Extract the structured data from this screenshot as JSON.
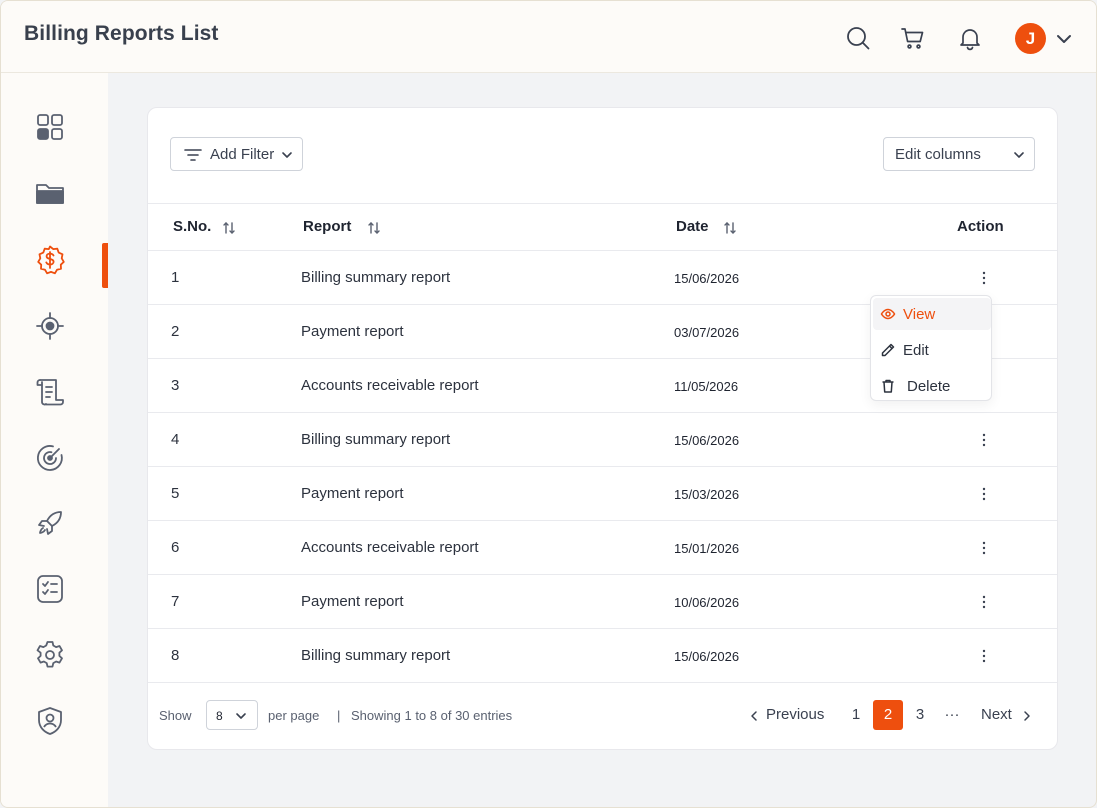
{
  "header": {
    "title": "Billing Reports List",
    "icons": [
      "search-icon",
      "cart-icon",
      "bell-icon"
    ],
    "user_initial": "J"
  },
  "sidebar": {
    "items": [
      {
        "icon": "dashboard-grid-icon",
        "active": false
      },
      {
        "icon": "folder-icon",
        "active": false
      },
      {
        "icon": "billing-dollar-icon",
        "active": true
      },
      {
        "icon": "target-icon",
        "active": false
      },
      {
        "icon": "scroll-document-icon",
        "active": false
      },
      {
        "icon": "radar-icon",
        "active": false
      },
      {
        "icon": "rocket-icon",
        "active": false
      },
      {
        "icon": "checklist-icon",
        "active": false
      },
      {
        "icon": "gear-icon",
        "active": false
      },
      {
        "icon": "shield-user-icon",
        "active": false
      }
    ]
  },
  "toolbar": {
    "filter_label": "Add Filter",
    "columns_label": "Edit columns"
  },
  "table": {
    "headers": {
      "sno": "S.No.",
      "report": "Report",
      "date": "Date",
      "action": "Action"
    },
    "rows": [
      {
        "sno": "1",
        "report": "Billing summary report",
        "date": "15/06/2026"
      },
      {
        "sno": "2",
        "report": "Payment report",
        "date": "03/07/2026"
      },
      {
        "sno": "3",
        "report": "Accounts receivable report",
        "date": "11/05/2026"
      },
      {
        "sno": "4",
        "report": "Billing summary report",
        "date": "15/06/2026"
      },
      {
        "sno": "5",
        "report": "Payment report",
        "date": "15/03/2026"
      },
      {
        "sno": "6",
        "report": "Accounts receivable report",
        "date": "15/01/2026"
      },
      {
        "sno": "7",
        "report": "Payment report",
        "date": "10/06/2026"
      },
      {
        "sno": "8",
        "report": "Billing summary report",
        "date": "15/06/2026"
      }
    ]
  },
  "action_menu": {
    "view": "View",
    "edit": "Edit",
    "delete": "Delete"
  },
  "footer": {
    "show_label": "Show",
    "per_page_value": "8",
    "per_page_label": "per page",
    "separator": "|",
    "showing_text": "Showing 1 to 8 of 30 entries",
    "previous_label": "Previous",
    "next_label": "Next",
    "pages": [
      "1",
      "2",
      "3"
    ],
    "ellipsis": "···",
    "current_page": "2"
  },
  "colors": {
    "accent": "#ee4f0e",
    "background": "#f2f3f5",
    "card": "#ffffff"
  }
}
